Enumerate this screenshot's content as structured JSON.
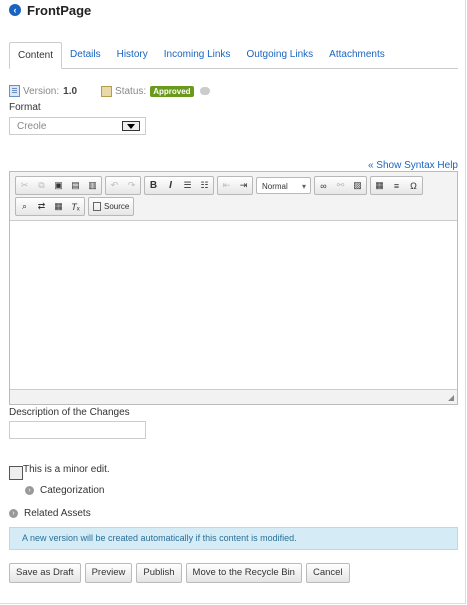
{
  "header": {
    "title": "FrontPage",
    "back_icon": "chevron-left-icon"
  },
  "tabs": [
    {
      "label": "Content",
      "active": true
    },
    {
      "label": "Details"
    },
    {
      "label": "History"
    },
    {
      "label": "Incoming Links"
    },
    {
      "label": "Outgoing Links"
    },
    {
      "label": "Attachments"
    }
  ],
  "meta": {
    "version_label": "Version:",
    "version_value": "1.0",
    "status_label": "Status:",
    "status_badge": "Approved",
    "status_color": "#6a9a1c"
  },
  "format": {
    "label": "Format",
    "value": "Creole"
  },
  "syntax_help": "« Show Syntax Help",
  "editor": {
    "style_combo": "Normal",
    "source_label": "Source"
  },
  "description": {
    "label": "Description of the Changes",
    "value": ""
  },
  "minor_edit": {
    "label": "This is a minor edit.",
    "checked": false
  },
  "categorization": {
    "label": "Categorization"
  },
  "related_assets": {
    "label": "Related Assets"
  },
  "info_message": "A new version will be created automatically if this content is modified.",
  "buttons": {
    "save_draft": "Save as Draft",
    "preview": "Preview",
    "publish": "Publish",
    "recycle": "Move to the Recycle Bin",
    "cancel": "Cancel"
  }
}
